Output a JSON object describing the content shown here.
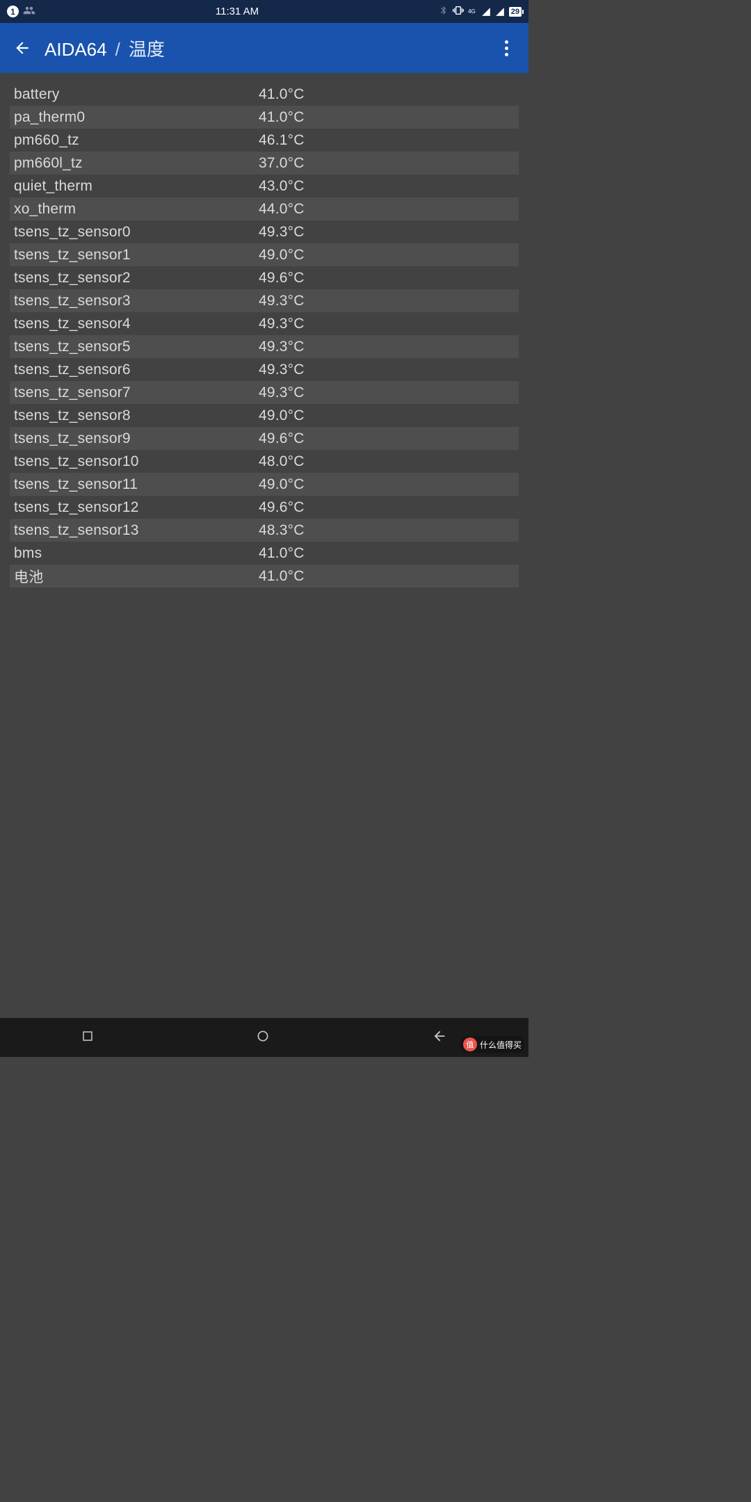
{
  "status": {
    "notif_count": "1",
    "time": "11:31 AM",
    "signal_labels": [
      "4G"
    ],
    "battery": "29"
  },
  "header": {
    "app_name": "AIDA64",
    "sep": "/",
    "page_title": "温度"
  },
  "rows": [
    {
      "label": "battery",
      "value": "41.0°C"
    },
    {
      "label": "pa_therm0",
      "value": "41.0°C"
    },
    {
      "label": "pm660_tz",
      "value": "46.1°C"
    },
    {
      "label": "pm660l_tz",
      "value": "37.0°C"
    },
    {
      "label": "quiet_therm",
      "value": "43.0°C"
    },
    {
      "label": "xo_therm",
      "value": "44.0°C"
    },
    {
      "label": "tsens_tz_sensor0",
      "value": "49.3°C"
    },
    {
      "label": "tsens_tz_sensor1",
      "value": "49.0°C"
    },
    {
      "label": "tsens_tz_sensor2",
      "value": "49.6°C"
    },
    {
      "label": "tsens_tz_sensor3",
      "value": "49.3°C"
    },
    {
      "label": "tsens_tz_sensor4",
      "value": "49.3°C"
    },
    {
      "label": "tsens_tz_sensor5",
      "value": "49.3°C"
    },
    {
      "label": "tsens_tz_sensor6",
      "value": "49.3°C"
    },
    {
      "label": "tsens_tz_sensor7",
      "value": "49.3°C"
    },
    {
      "label": "tsens_tz_sensor8",
      "value": "49.0°C"
    },
    {
      "label": "tsens_tz_sensor9",
      "value": "49.6°C"
    },
    {
      "label": "tsens_tz_sensor10",
      "value": "48.0°C"
    },
    {
      "label": "tsens_tz_sensor11",
      "value": "49.0°C"
    },
    {
      "label": "tsens_tz_sensor12",
      "value": "49.6°C"
    },
    {
      "label": "tsens_tz_sensor13",
      "value": "48.3°C"
    },
    {
      "label": "bms",
      "value": "41.0°C"
    },
    {
      "label": "电池",
      "value": "41.0°C"
    }
  ],
  "watermark": {
    "badge": "值",
    "text": "什么值得买"
  }
}
